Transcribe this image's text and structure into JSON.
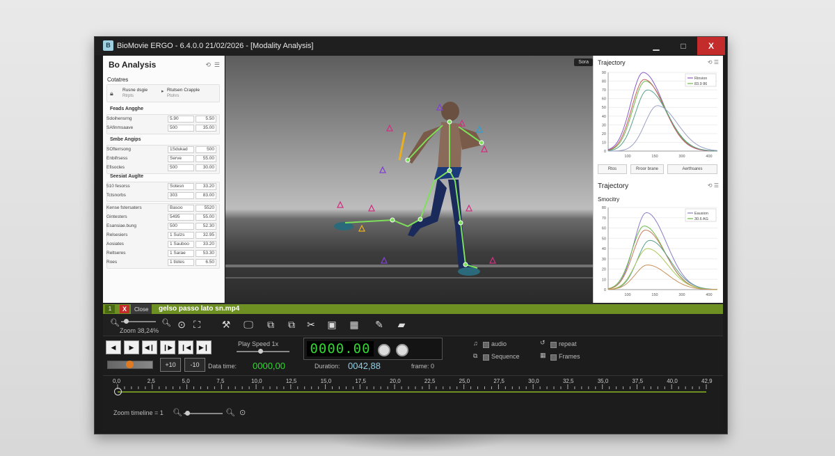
{
  "window": {
    "title": "BioMovie ERGO - 6.4.0.0  21/02/2026 - [Modality Analysis]",
    "app_icon": "app-logo-icon",
    "buttons": {
      "minimize": "▁",
      "maximize": "□",
      "close": "X"
    }
  },
  "left_panel": {
    "title": "Bo Analysis",
    "section": "Cotatres",
    "card": {
      "left_label": "Rusne dsgie",
      "left_sub": "Rtrpts",
      "right_label": "Rtutsen Crapple",
      "right_sub": "Ptohrs"
    },
    "groups": [
      {
        "title": "Feads Angghe",
        "rows": [
          {
            "label": "Sdoihensrng",
            "v1": "5.90",
            "v2": "5.50"
          },
          {
            "label": "SAfinmsaave",
            "v1": "500",
            "v2": "35.00"
          }
        ]
      },
      {
        "title": "Smbe Angips",
        "rows": [
          {
            "label": "SOfterrsong",
            "v1": "1Sdukad",
            "v2": "500"
          },
          {
            "label": "Enbifrsess",
            "v1": "Serve",
            "v2": "55.00"
          },
          {
            "label": "Efisocles",
            "v1": "500",
            "v2": "30.00"
          }
        ]
      },
      {
        "title": "Seesiat Auglte",
        "rows": [
          {
            "label": "510 fesorss",
            "v1": "Sotesn",
            "v2": "33.20"
          },
          {
            "label": "Tctsnorbs",
            "v1": "303",
            "v2": "83.00"
          }
        ]
      },
      {
        "title": "",
        "rows": [
          {
            "label": "Kense fstersaters",
            "v1": "Basoo",
            "v2": "5520"
          },
          {
            "label": "Gintesters",
            "v1": "5495",
            "v2": "55.00"
          },
          {
            "label": "Esansiae.bung",
            "v1": "500",
            "v2": "52.30"
          },
          {
            "label": "Relsesiers",
            "v1": "1 Sulzs",
            "v2": "32.95"
          },
          {
            "label": "Aosiates",
            "v1": "1 Sauboo",
            "v2": "33.20"
          },
          {
            "label": "Reltseres",
            "v1": "1 Sarae",
            "v2": "53.30"
          },
          {
            "label": "Roes",
            "v1": "1 tlotes",
            "v2": "6.50"
          }
        ]
      }
    ]
  },
  "video": {
    "tag": "Sora"
  },
  "right_panel": {
    "chart1_title": "Trajectory",
    "chart2_title": "Trajectory",
    "chart2_subtitle": "Smocitry",
    "buttons": [
      "Rtos",
      "Rroor brane",
      "Aerthsares"
    ]
  },
  "chart_data": [
    {
      "type": "line",
      "title": "Trajectory",
      "x_ticks": [
        "100",
        "150",
        "300",
        "400"
      ],
      "y_ticks": [
        "0",
        "10",
        "20",
        "30",
        "40",
        "50",
        "60",
        "70",
        "80",
        "90"
      ],
      "ylim": [
        0,
        90
      ],
      "legend": [
        "Rinvion",
        "83.9 86"
      ],
      "series": [
        {
          "color": "#8a5ac8",
          "peak": 90,
          "peak_at": 0.32
        },
        {
          "color": "#6aba4a",
          "peak": 80,
          "peak_at": 0.34
        },
        {
          "color": "#c85a5a",
          "peak": 82,
          "peak_at": 0.33
        },
        {
          "color": "#5aa08a",
          "peak": 70,
          "peak_at": 0.36
        },
        {
          "color": "#9aa0c8",
          "peak": 52,
          "peak_at": 0.45
        }
      ]
    },
    {
      "type": "line",
      "title": "Smocitry",
      "x_ticks": [
        "100",
        "150",
        "300",
        "400"
      ],
      "y_ticks": [
        "0",
        "10",
        "20",
        "30",
        "40",
        "50",
        "60",
        "70",
        "80"
      ],
      "ylim": [
        0,
        80
      ],
      "legend": [
        "Eausion",
        "30.6 AG"
      ],
      "series": [
        {
          "color": "#8a7ac8",
          "peak": 75,
          "peak_at": 0.35
        },
        {
          "color": "#6aba4a",
          "peak": 62,
          "peak_at": 0.33
        },
        {
          "color": "#c87a5a",
          "peak": 58,
          "peak_at": 0.34
        },
        {
          "color": "#5aa08a",
          "peak": 48,
          "peak_at": 0.38
        },
        {
          "color": "#aac85a",
          "peak": 40,
          "peak_at": 0.36
        },
        {
          "color": "#c8905a",
          "peak": 24,
          "peak_at": 0.36
        }
      ]
    }
  ],
  "filebar": {
    "index": "1",
    "close_x": "X",
    "close_label": "Close",
    "filename": "gelso passo lato sn.mp4"
  },
  "toolbar": {
    "zoom_label": "Zoom 38,24%"
  },
  "controls": {
    "play_speed": "Play Speed 1x",
    "digital": "0000.00",
    "data_time_label": "Data time:",
    "data_time_value": "0000,00",
    "duration_label": "Duration:",
    "duration_value": "0042,88",
    "frame_label": "frame: 0",
    "plus10": "+10",
    "minus10": "-10",
    "audio": "audio",
    "sequence": "Sequence",
    "repeat": "repeat",
    "frames": "Frames"
  },
  "timeline": {
    "ticks": [
      "0,0",
      "2,5",
      "5,0",
      "7,5",
      "10,0",
      "12,5",
      "15,0",
      "17,5",
      "20,0",
      "22,5",
      "25,0",
      "27,5",
      "30,0",
      "32,5",
      "35,0",
      "37,5",
      "40,0",
      "42,9"
    ],
    "zoom_label": "Zoom timeline = 1"
  }
}
